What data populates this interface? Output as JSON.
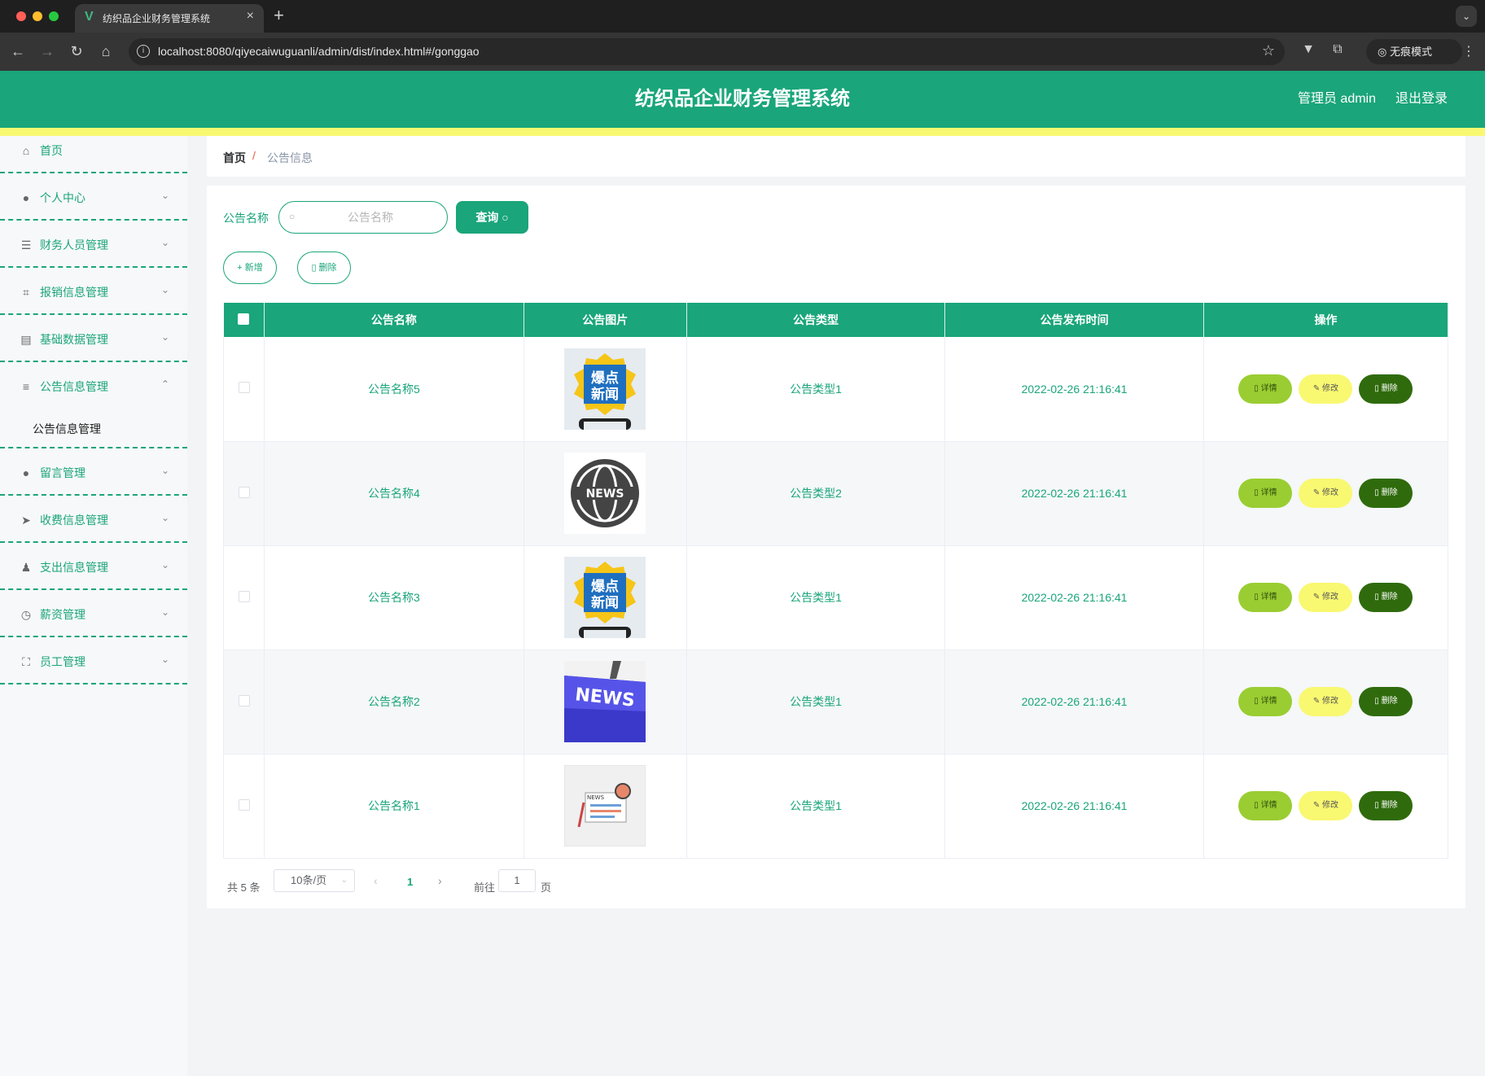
{
  "browser": {
    "tab_title": "纺织品企业财务管理系统",
    "url": "localhost:8080/qiyecaiwuguanli/admin/dist/index.html#/gonggao",
    "incognito_label": "无痕模式"
  },
  "header": {
    "title": "纺织品企业财务管理系统",
    "user": "管理员 admin",
    "logout": "退出登录"
  },
  "colors": {
    "primary": "#1aa57a",
    "accent_yellow": "#f9f871",
    "detail_btn": "#9acd32",
    "delete_btn": "#2f6b0c"
  },
  "sidebar": {
    "items": [
      {
        "label": "首页",
        "icon": "home-icon"
      },
      {
        "label": "个人中心",
        "icon": "user-icon"
      },
      {
        "label": "财务人员管理",
        "icon": "sliders-icon"
      },
      {
        "label": "报销信息管理",
        "icon": "crop-icon"
      },
      {
        "label": "基础数据管理",
        "icon": "clipboard-icon"
      },
      {
        "label": "公告信息管理",
        "icon": "list-icon",
        "sub": [
          "公告信息管理"
        ]
      },
      {
        "label": "留言管理",
        "icon": "user-icon"
      },
      {
        "label": "收费信息管理",
        "icon": "send-icon"
      },
      {
        "label": "支出信息管理",
        "icon": "user-stand-icon"
      },
      {
        "label": "薪资管理",
        "icon": "compass-icon"
      },
      {
        "label": "员工管理",
        "icon": "fullscreen-icon"
      }
    ]
  },
  "breadcrumb": {
    "home": "首页",
    "current": "公告信息"
  },
  "search": {
    "label": "公告名称",
    "placeholder": "公告名称",
    "button": "查询"
  },
  "toolbar": {
    "add": "新增",
    "delete": "删除"
  },
  "table": {
    "headers": [
      "公告名称",
      "公告图片",
      "公告类型",
      "公告发布时间",
      "操作"
    ],
    "rows": [
      {
        "name": "公告名称5",
        "image": "baodian-news",
        "type": "公告类型1",
        "time": "2022-02-26 21:16:41"
      },
      {
        "name": "公告名称4",
        "image": "globe-news",
        "type": "公告类型2",
        "time": "2022-02-26 21:16:41"
      },
      {
        "name": "公告名称3",
        "image": "baodian-news",
        "type": "公告类型1",
        "time": "2022-02-26 21:16:41"
      },
      {
        "name": "公告名称2",
        "image": "news-key",
        "type": "公告类型1",
        "time": "2022-02-26 21:16:41"
      },
      {
        "name": "公告名称1",
        "image": "newspaper-illustration",
        "type": "公告类型1",
        "time": "2022-02-26 21:16:41"
      }
    ],
    "actions": {
      "detail": "详情",
      "edit": "修改",
      "delete": "删除"
    }
  },
  "pagination": {
    "total": "共 5 条",
    "page_size": "10条/页",
    "current": "1",
    "goto": "前往",
    "goto_value": "1",
    "unit": "页"
  }
}
